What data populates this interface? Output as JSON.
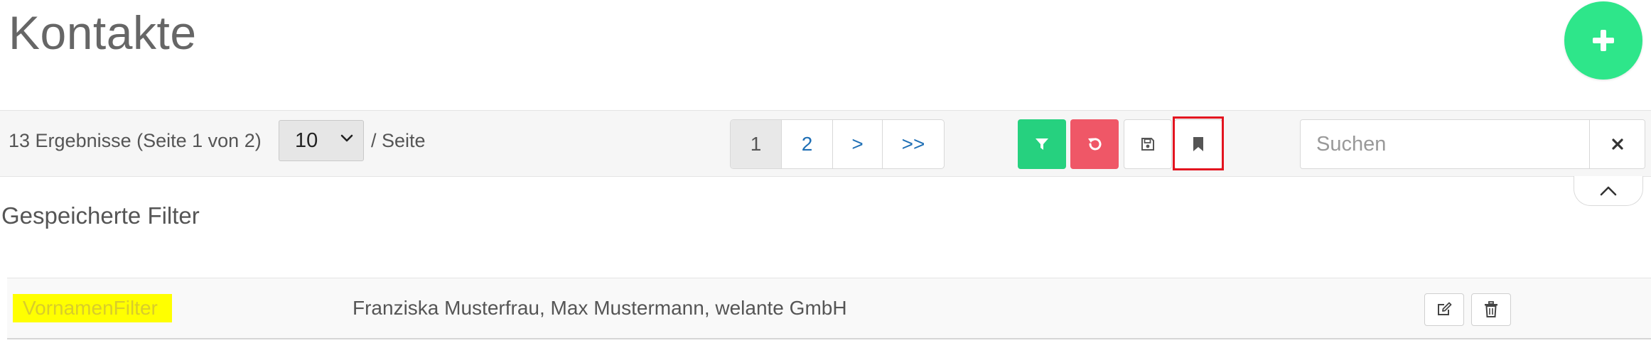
{
  "header": {
    "title": "Kontakte",
    "add_button_icon": "plus-icon"
  },
  "toolbar": {
    "results_text": "13 Ergebnisse (Seite 1 von 2)",
    "per_page": {
      "selected": "10",
      "suffix": "/ Seite"
    },
    "pagination": [
      {
        "label": "1",
        "active": true
      },
      {
        "label": "2",
        "active": false
      },
      {
        "label": ">",
        "active": false
      },
      {
        "label": ">>",
        "active": false
      }
    ],
    "actions": {
      "filter_icon": "filter-icon",
      "reset_icon": "undo-icon",
      "save_icon": "floppy-disk-icon",
      "bookmark_icon": "bookmark-icon"
    },
    "search": {
      "placeholder": "Suchen",
      "value": "",
      "clear_icon": "close-icon"
    }
  },
  "saved_filters": {
    "heading": "Gespeicherte Filter",
    "collapse_icon": "chevron-up-icon",
    "rows": [
      {
        "name": "VornamenFilter",
        "values": "Franziska Musterfrau, Max Mustermann, welante GmbH",
        "edit_icon": "edit-icon",
        "delete_icon": "trash-icon"
      }
    ]
  },
  "colors": {
    "add_button": "#2ee68a",
    "filter_button": "#26d17f",
    "reset_button": "#ef5767",
    "link": "#1f6fb5",
    "highlight_yellow": "#ffff00",
    "annotation_red": "#e3141f"
  }
}
